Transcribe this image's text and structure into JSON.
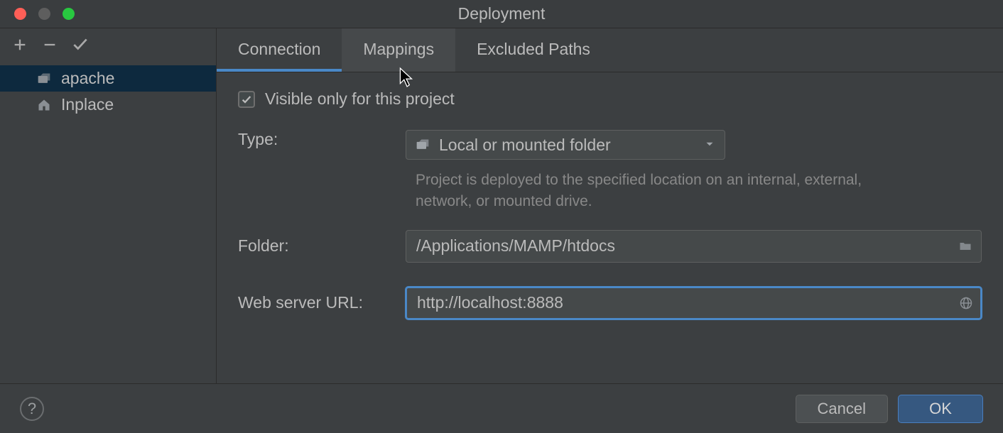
{
  "window": {
    "title": "Deployment"
  },
  "sidebar": {
    "items": [
      {
        "label": "apache",
        "icon": "server-icon",
        "selected": true
      },
      {
        "label": "Inplace",
        "icon": "home-icon",
        "selected": false
      }
    ]
  },
  "tabs": [
    {
      "label": "Connection",
      "state": "active"
    },
    {
      "label": "Mappings",
      "state": "hover"
    },
    {
      "label": "Excluded Paths",
      "state": ""
    }
  ],
  "form": {
    "visible_only_label": "Visible only for this project",
    "visible_only_checked": true,
    "type_label": "Type:",
    "type_value": "Local or mounted folder",
    "type_desc": "Project is deployed to the specified location on an internal, external, network, or mounted drive.",
    "folder_label": "Folder:",
    "folder_value": "/Applications/MAMP/htdocs",
    "url_label": "Web server URL:",
    "url_value": "http://localhost:8888"
  },
  "footer": {
    "cancel_label": "Cancel",
    "ok_label": "OK"
  }
}
